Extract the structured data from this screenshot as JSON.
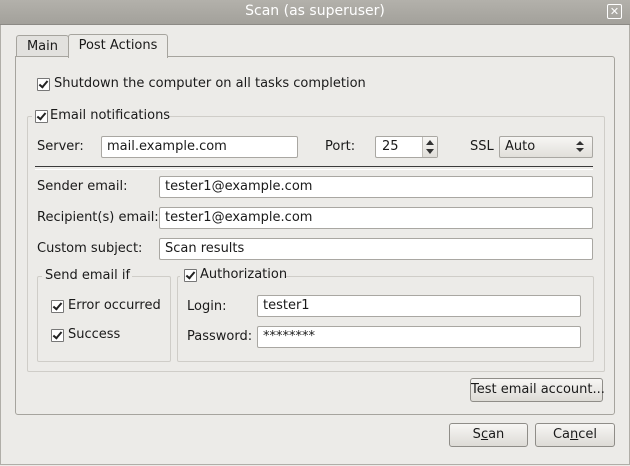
{
  "window": {
    "title": "Scan (as superuser)",
    "close_glyph": "✕"
  },
  "tabs": [
    {
      "label": "Main"
    },
    {
      "label": "Post Actions"
    }
  ],
  "shutdown": {
    "label": "Shutdown the computer on all tasks completion",
    "checked": true
  },
  "email": {
    "label": "Email notifications",
    "checked": true,
    "server_label": "Server:",
    "server_value": "mail.example.com",
    "port_label": "Port:",
    "port_value": "25",
    "ssl_label": "SSL",
    "ssl_value": "Auto",
    "sender_label": "Sender email:",
    "sender_value": "tester1@example.com",
    "recipient_label": "Recipient(s) email:",
    "recipient_value": "tester1@example.com",
    "subject_label": "Custom subject:",
    "subject_value": "Scan results"
  },
  "send_if": {
    "label": "Send email if",
    "error_label": "Error occurred",
    "error_checked": true,
    "success_label": "Success",
    "success_checked": true
  },
  "auth": {
    "label": "Authorization",
    "checked": true,
    "login_label": "Login:",
    "login_value": "tester1",
    "password_label": "Password:",
    "password_value": "********"
  },
  "buttons": {
    "test": "Test email account...",
    "scan_pre": "S",
    "scan_acc": "c",
    "scan_post": "an",
    "cancel_pre": "Ca",
    "cancel_acc": "n",
    "cancel_post": "cel"
  },
  "colors": {
    "titlebar": "#a7a59f",
    "window_bg": "#ecebe8"
  }
}
